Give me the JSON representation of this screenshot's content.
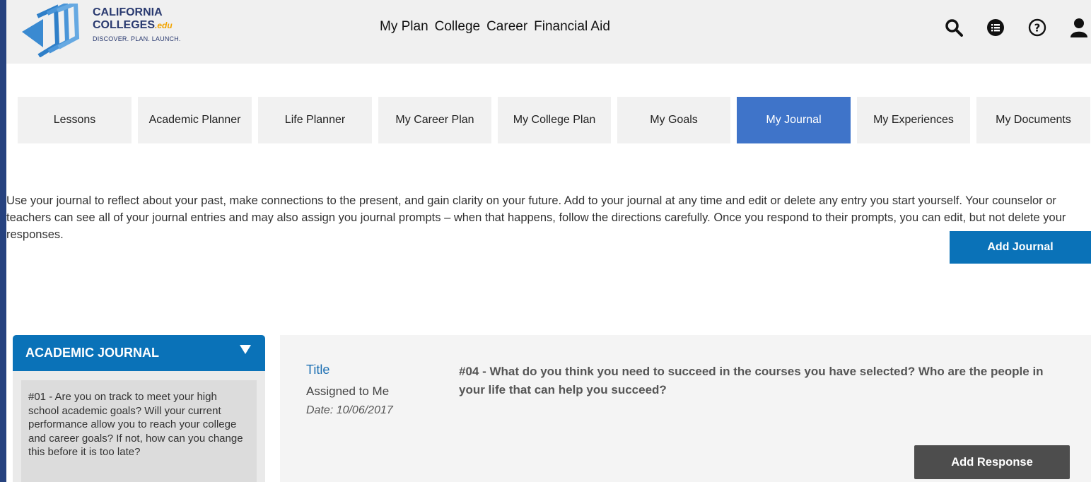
{
  "brand": {
    "line1": "CALIFORNIA",
    "line2": "COLLEGES",
    "edu": ".edu",
    "tagline": "DISCOVER. PLAN. LAUNCH."
  },
  "topnav": [
    "My Plan",
    "College",
    "Career",
    "Financial Aid"
  ],
  "icons": [
    "search-icon",
    "list-icon",
    "help-icon",
    "user-icon"
  ],
  "tabs": [
    "Lessons",
    "Academic Planner",
    "Life Planner",
    "My Career Plan",
    "My College Plan",
    "My Goals",
    "My Journal",
    "My Experiences",
    "My Documents"
  ],
  "active_tab": "My Journal",
  "intro": "Use your journal to reflect about your past, make connections to the present, and gain clarity on your future. Add to your journal at any time and edit or delete any entry you start yourself. Your counselor or teachers can see all of your journal entries and may also assign you journal prompts – when that happens, follow the directions carefully. Once you respond to their prompts, you can edit, but not delete your responses.",
  "add_journal_label": "Add Journal",
  "journal_panel": {
    "heading": "ACADEMIC JOURNAL",
    "items": [
      "#01 -  Are you on track to meet your high school academic goals? Will your current performance allow you to reach your college and career goals? If not, how can you change this before it is too late?"
    ]
  },
  "entry": {
    "title_label": "Title",
    "assigned_label": "Assigned to Me",
    "date": "Date: 10/06/2017",
    "question": "#04 - What do you think you need to succeed in the courses you have selected? Who are the people in your life that can help you succeed?",
    "add_response_label": "Add Response"
  },
  "colors": {
    "background": "#26427f",
    "active_tab": "#3f74c9",
    "primary_button": "#0a72b8",
    "dark_button": "#4d4d4d"
  }
}
